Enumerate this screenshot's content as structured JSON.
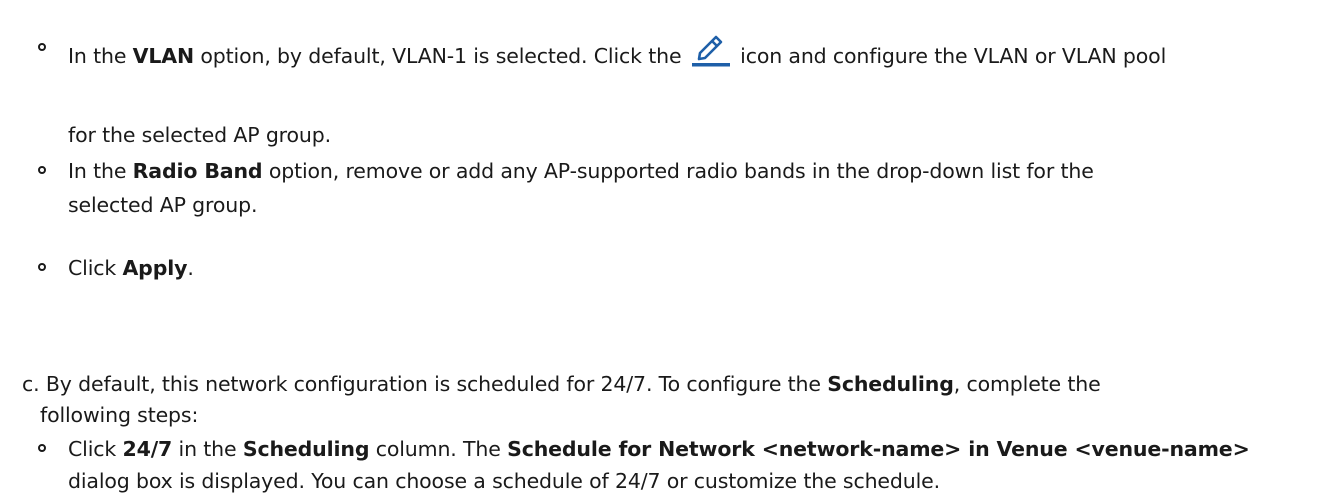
{
  "vlan": {
    "t1": "In the ",
    "b1": "VLAN",
    "t2": " option, by default, VLAN-1 is selected. Click the ",
    "icon": "edit-pencil-icon",
    "t3": " icon and configure the VLAN or VLAN pool",
    "t4": "for the selected AP group."
  },
  "radio": {
    "t1": "In the ",
    "b1": "Radio Band",
    "t2": " option, remove or add any AP-supported radio bands in the drop-down list for the",
    "t3": "selected AP group."
  },
  "apply": {
    "t1": "Click ",
    "b1": "Apply",
    "t2": "."
  },
  "scheduling": {
    "t1": "c. By default, this network configuration is scheduled for 24/7. To configure the ",
    "b1": "Scheduling",
    "t2": ", complete the",
    "t3": "following steps:"
  },
  "click247": {
    "t1": "Click ",
    "b1": "24/7",
    "t2": " in the ",
    "b2": "Scheduling",
    "t3": " column. The ",
    "b3": "Schedule for Network <network-name> in Venue <venue-name>",
    "t4": "dialog box is displayed. You can choose a schedule of 24/7 or customize the schedule."
  },
  "colors": {
    "text": "#1a1a1a",
    "icon_blue": "#1e5fa8"
  }
}
